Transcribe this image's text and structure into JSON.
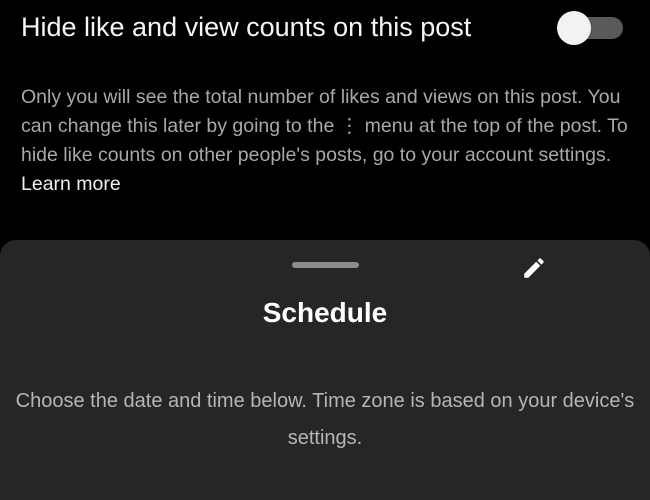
{
  "hide_counts": {
    "title": "Hide like and view counts on this post",
    "toggle_state": "off",
    "description_before": "Only you will see the total number of likes and views on this post. You can change this later by going to the ⋮ menu at the top of the post. To hide like counts on other people's posts, go to your account settings.",
    "learn_more": "Learn more"
  },
  "schedule_sheet": {
    "edit_icon": "pencil-icon",
    "title": "Schedule",
    "subtitle": "Choose the date and time below. Time zone is based on your device's settings."
  },
  "colors": {
    "background": "#000000",
    "sheet_background": "#262626",
    "primary_text": "#ffffff",
    "secondary_text": "#a8a8a8",
    "toggle_track": "#5a5a5a",
    "toggle_knob": "#f2f2f2"
  }
}
